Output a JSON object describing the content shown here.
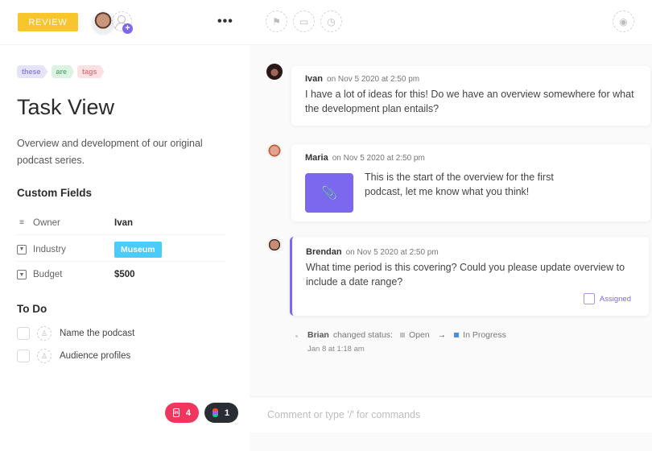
{
  "header": {
    "status_label": "REVIEW",
    "more_label": "•••",
    "icons": [
      "flag-icon",
      "calendar-icon",
      "clock-icon",
      "eye-icon"
    ]
  },
  "colors": {
    "status": "#f9c52c",
    "accent": "#7b68ee",
    "industry_badge": "#49ccf9",
    "status_open": "#c4c4c4",
    "status_in_progress": "#4a90e2"
  },
  "tags": [
    {
      "label": "these",
      "color": "purple"
    },
    {
      "label": "are",
      "color": "green"
    },
    {
      "label": "tags",
      "color": "red"
    }
  ],
  "task": {
    "title": "Task View",
    "description": "Overview and development of our original podcast series."
  },
  "custom_fields": {
    "title": "Custom Fields",
    "fields": [
      {
        "label": "Owner",
        "value": "Ivan",
        "icon": "text-lines-icon"
      },
      {
        "label": "Industry",
        "value": "Museum",
        "icon": "dropdown-icon"
      },
      {
        "label": "Budget",
        "value": "$500",
        "icon": "dropdown-icon"
      }
    ]
  },
  "todo": {
    "title": "To Do",
    "items": [
      {
        "label": "Name the podcast",
        "checked": false
      },
      {
        "label": "Audience profiles",
        "checked": false
      }
    ]
  },
  "integrations": [
    {
      "name": "linkedin",
      "count": "4"
    },
    {
      "name": "figma",
      "count": "1"
    }
  ],
  "comments": [
    {
      "author": "Ivan",
      "time": "on Nov 5 2020 at 2:50 pm",
      "text": "I have a lot of ideas for this! Do we have an overview somewhere for what the development plan entails?"
    },
    {
      "author": "Maria",
      "time": "on Nov 5 2020 at 2:50 pm",
      "text": "This is the start of the overview for the first podcast, let me know what you think!",
      "attachment": "paperclip-icon"
    },
    {
      "author": "Brendan",
      "time": "on Nov 5 2020 at 2:50 pm",
      "text": "What time period is this covering? Could you please update overview to include a date range?",
      "assigned_label": "Assigned"
    }
  ],
  "activity": {
    "who": "Brian",
    "action": "changed status:",
    "from": "Open",
    "arrow": "→",
    "to": "In Progress",
    "time": "Jan 8 at 1:18 am"
  },
  "comment_input": {
    "placeholder": "Comment or type '/' for commands",
    "value": ""
  }
}
